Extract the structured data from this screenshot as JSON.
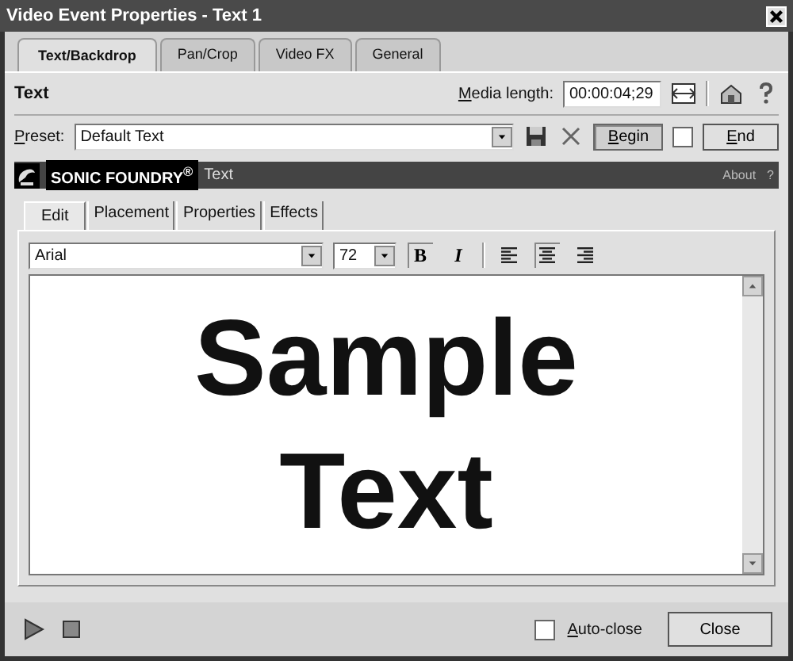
{
  "window": {
    "title": "Video Event Properties - Text 1"
  },
  "tabs": [
    {
      "label": "Text/Backdrop",
      "selected": true
    },
    {
      "label": "Pan/Crop",
      "selected": false
    },
    {
      "label": "Video FX",
      "selected": false
    },
    {
      "label": "General",
      "selected": false
    }
  ],
  "header": {
    "title": "Text",
    "media_length_label": "Media length:",
    "media_length": "00:00:04;29"
  },
  "preset": {
    "label": "Preset:",
    "value": "Default Text",
    "begin": "Begin",
    "end_checked": false,
    "end": "End"
  },
  "banner": {
    "brand": "SONIC FOUNDRY$^{®}$",
    "title": "Text",
    "about": "About",
    "help": "?"
  },
  "inner_tabs": [
    {
      "label": "Edit",
      "selected": true
    },
    {
      "label": "Placement",
      "selected": false
    },
    {
      "label": "Properties",
      "selected": false
    },
    {
      "label": "Effects",
      "selected": false
    }
  ],
  "format": {
    "font": "Arial",
    "size": "72",
    "bold": {
      "label": "B",
      "selected": true
    },
    "italic": {
      "label": "I",
      "selected": false
    },
    "align": [
      {
        "kind": "left",
        "selected": false
      },
      {
        "kind": "center",
        "selected": true
      },
      {
        "kind": "right",
        "selected": false
      }
    ]
  },
  "editor": {
    "lines": [
      "Sample",
      "Text"
    ]
  },
  "footer": {
    "auto_close_checked": false,
    "auto_close": "Auto-close",
    "close": "Close"
  }
}
